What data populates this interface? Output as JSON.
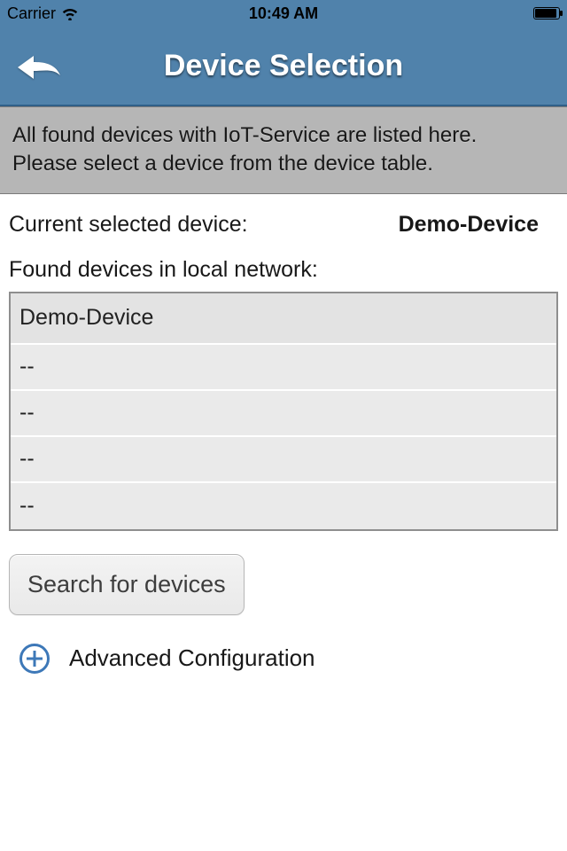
{
  "statusbar": {
    "carrier": "Carrier",
    "time": "10:49 AM"
  },
  "nav": {
    "title": "Device Selection"
  },
  "info": {
    "line1": "All found devices with IoT-Service are listed here.",
    "line2": "Please select a device from the device table."
  },
  "current": {
    "label": "Current selected device:",
    "value": "Demo-Device"
  },
  "devices": {
    "found_label": "Found devices in local network:",
    "rows": [
      "Demo-Device",
      "--",
      "--",
      "--",
      "--"
    ]
  },
  "search_button": "Search for devices",
  "advanced_label": "Advanced Configuration"
}
